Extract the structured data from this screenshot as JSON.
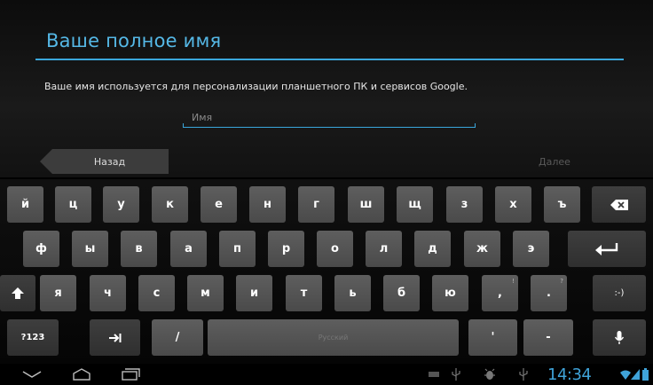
{
  "wizard": {
    "title": "Ваше полное имя",
    "description": "Ваше имя используется для персонализации планшетного ПК и сервисов Google.",
    "name_placeholder": "Имя",
    "name_value": "",
    "back_label": "Назад",
    "next_label": "Далее"
  },
  "keyboard": {
    "row1": [
      "й",
      "ц",
      "у",
      "к",
      "е",
      "н",
      "г",
      "ш",
      "щ",
      "з",
      "х",
      "ъ"
    ],
    "row2": [
      "ф",
      "ы",
      "в",
      "а",
      "п",
      "р",
      "о",
      "л",
      "д",
      "ж",
      "э"
    ],
    "row3": [
      "я",
      "ч",
      "с",
      "м",
      "и",
      "т",
      "ь",
      "б",
      "ю",
      ",",
      "."
    ],
    "row3_hints": [
      "",
      "",
      "",
      "",
      "",
      "",
      "",
      "",
      "",
      "!",
      "?"
    ],
    "smiley_label": ":-)",
    "symbols_label": "?123",
    "slash_label": "/",
    "space_label": "Русский",
    "apostrophe_label": "'",
    "dash_label": "-",
    "icons": {
      "backspace": "backspace-icon",
      "enter": "enter-icon",
      "shift": "shift-icon",
      "tab": "tab-icon",
      "mic": "microphone-icon"
    }
  },
  "system_bar": {
    "time": "14:34",
    "icons": [
      "back-icon",
      "home-icon",
      "recent-apps-icon",
      "keyboard-status-icon",
      "usb-icon",
      "android-debug-icon",
      "usb-icon",
      "wifi-icon",
      "signal-icon",
      "battery-icon"
    ]
  },
  "colors": {
    "accent": "#3aa7dc",
    "title": "#55b8e6",
    "key": "#555555",
    "background": "#000000"
  }
}
